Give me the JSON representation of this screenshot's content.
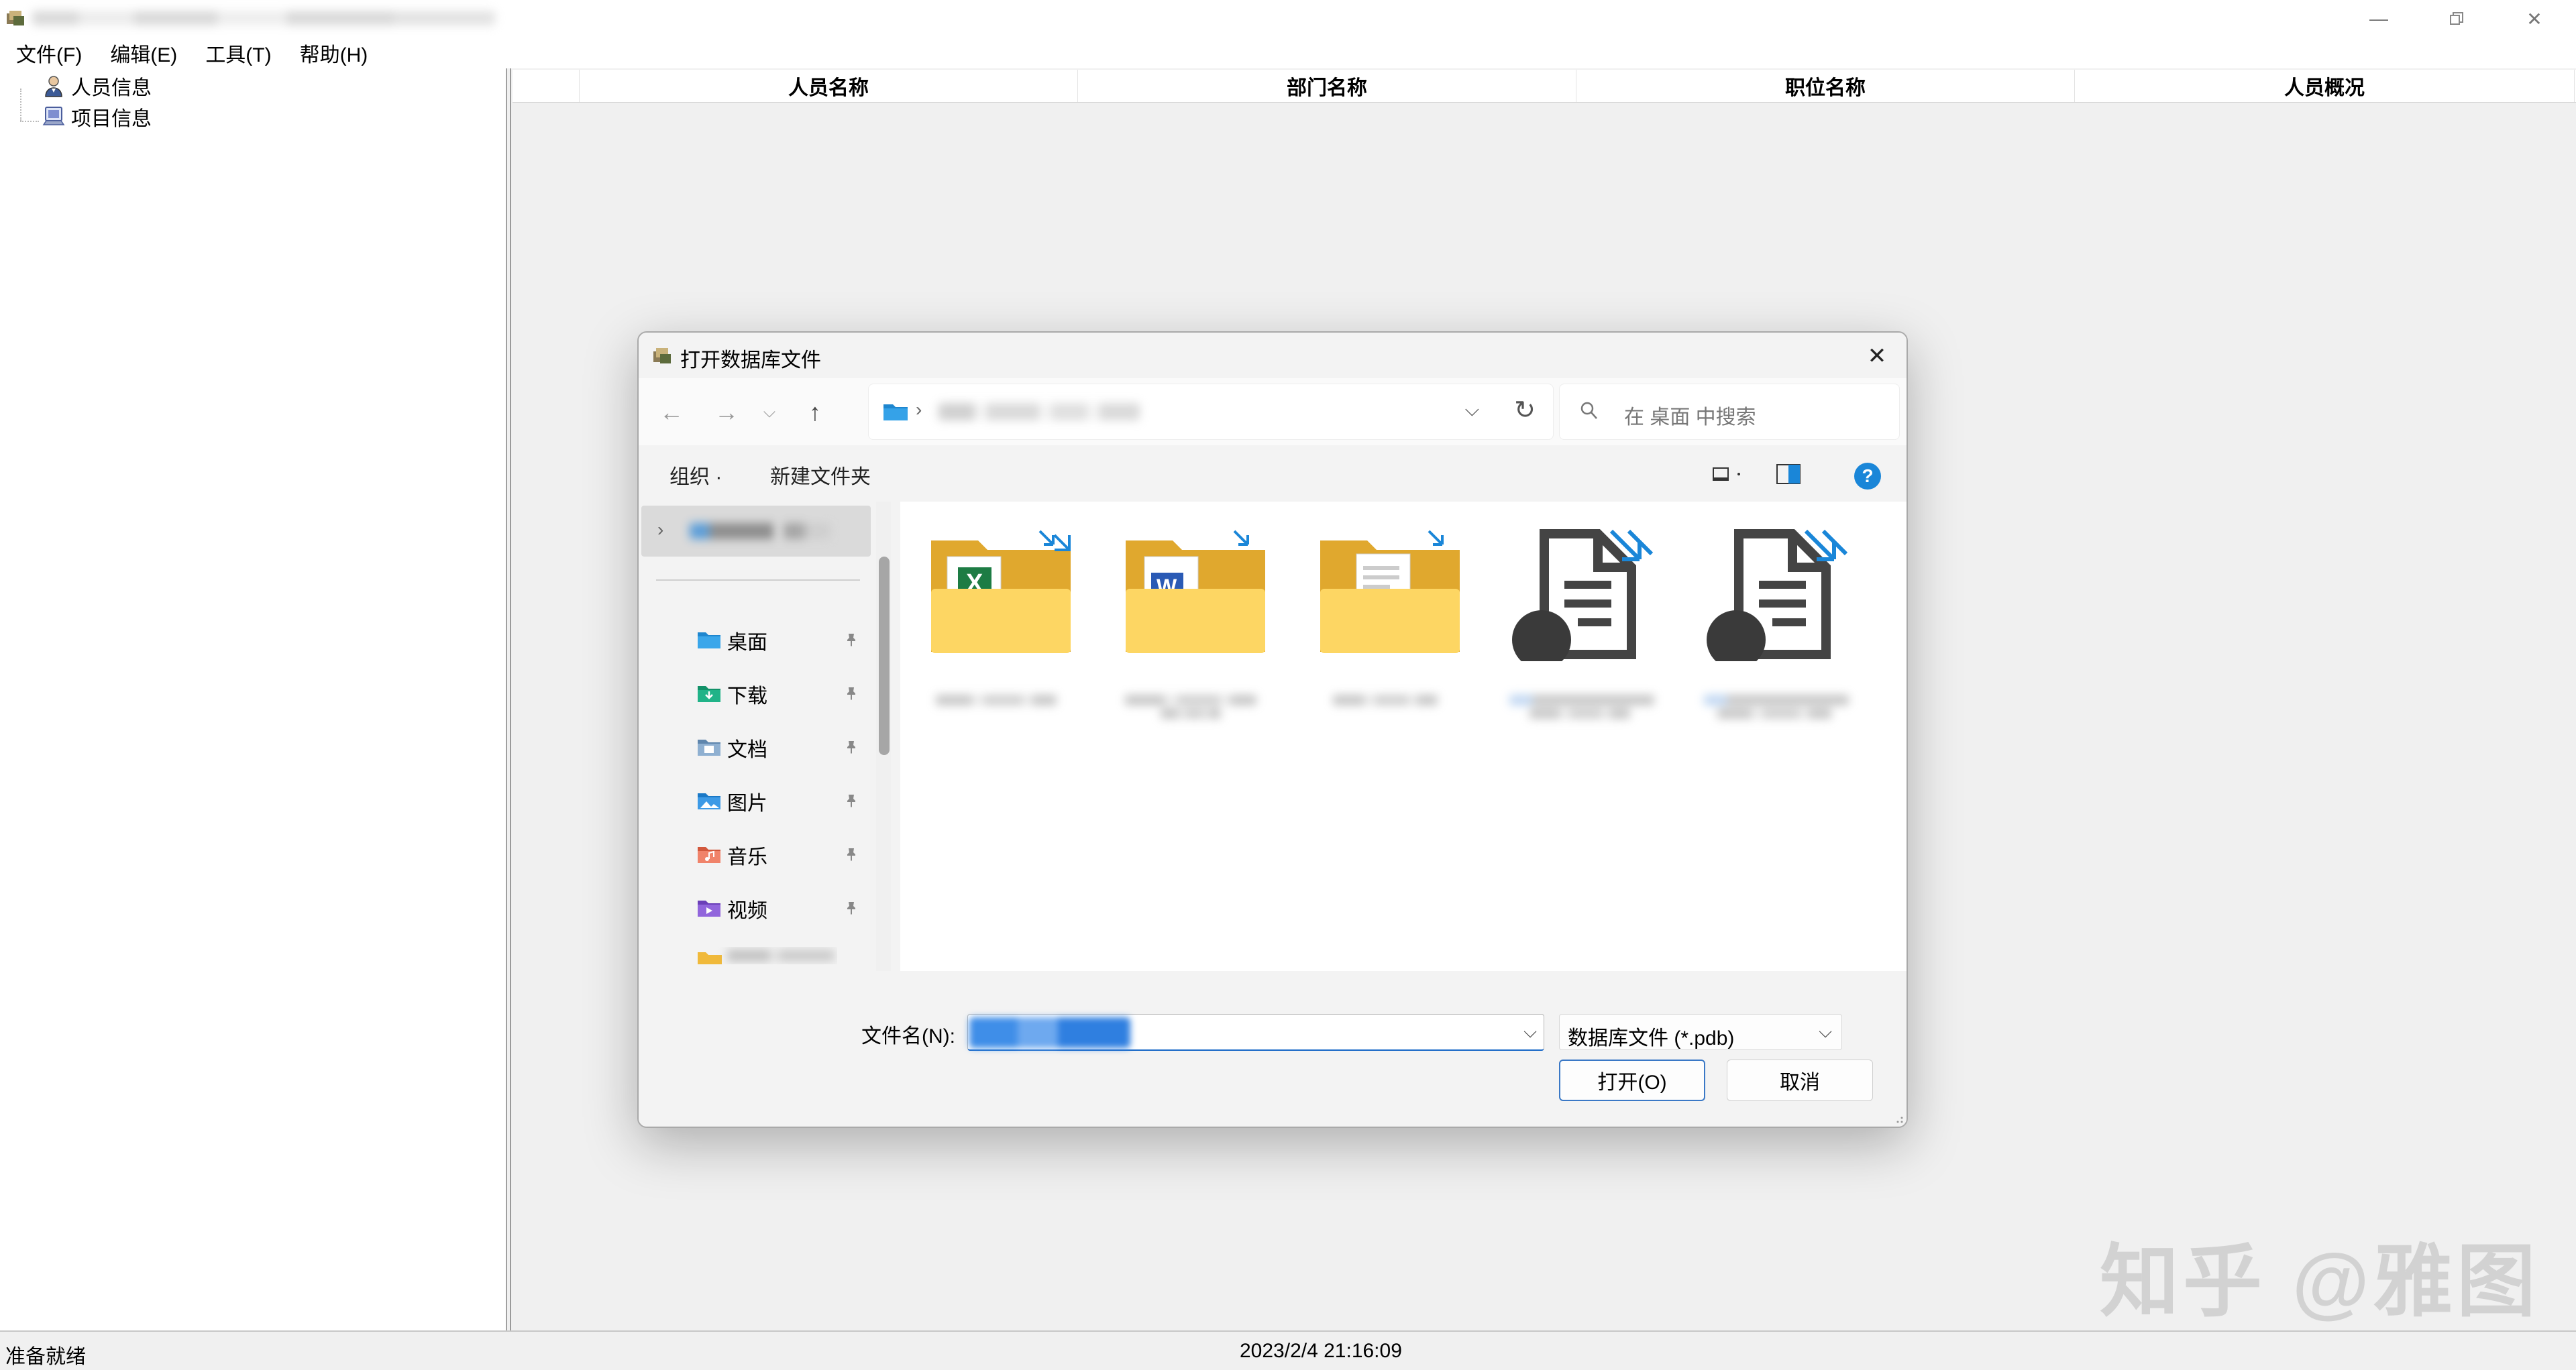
{
  "window": {
    "title": "",
    "minimize_icon": "minimize-icon",
    "restore_icon": "restore-icon",
    "close_icon": "close-icon"
  },
  "menu": [
    {
      "label": "文件(F)"
    },
    {
      "label": "编辑(E)"
    },
    {
      "label": "工具(T)"
    },
    {
      "label": "帮助(H)"
    }
  ],
  "tree": [
    {
      "label": "人员信息",
      "icon": "person-icon"
    },
    {
      "label": "项目信息",
      "icon": "project-icon"
    }
  ],
  "table": {
    "columns": [
      "",
      "人员名称",
      "部门名称",
      "职位名称",
      "人员概况"
    ]
  },
  "status": {
    "left": "准备就绪",
    "datetime": "2023/2/4 21:16:09"
  },
  "watermark": "知乎 @雅图",
  "dialog": {
    "title": "打开数据库文件",
    "search_placeholder": "在 桌面 中搜索",
    "organize_label": "组织 ·",
    "new_folder_label": "新建文件夹",
    "help_label": "?",
    "nav_items": [
      {
        "label": "桌面",
        "icon": "desktop-folder-icon",
        "color": "#1e90d6"
      },
      {
        "label": "下载",
        "icon": "download-folder-icon",
        "color": "#1aa37a"
      },
      {
        "label": "文档",
        "icon": "documents-folder-icon",
        "color": "#6a8fb4"
      },
      {
        "label": "图片",
        "icon": "pictures-folder-icon",
        "color": "#2a8ad6"
      },
      {
        "label": "音乐",
        "icon": "music-folder-icon",
        "color": "#e26d4d"
      },
      {
        "label": "视频",
        "icon": "videos-folder-icon",
        "color": "#7b4fc9"
      }
    ],
    "files": [
      {
        "type": "folder",
        "icon": "excel-folder-shortcut-icon"
      },
      {
        "type": "folder",
        "icon": "word-folder-shortcut-icon"
      },
      {
        "type": "folder",
        "icon": "pdf-folder-shortcut-icon"
      },
      {
        "type": "file",
        "icon": "database-file-shortcut-icon"
      },
      {
        "type": "file",
        "icon": "database-file-shortcut-icon"
      }
    ],
    "filename_label": "文件名(N):",
    "filetype_value": "数据库文件 (*.pdb)",
    "open_label": "打开(O)",
    "cancel_label": "取消"
  },
  "colors": {
    "accent": "#1a86d8",
    "folder": "#f5c542",
    "selection": "#3f8ee8"
  }
}
